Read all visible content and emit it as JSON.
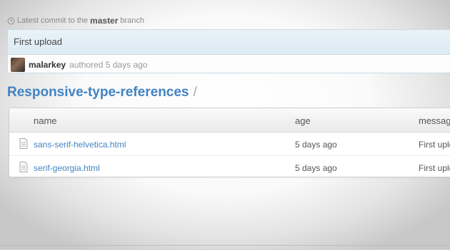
{
  "commit": {
    "latest_prefix": "Latest commit to the",
    "branch": "master",
    "branch_suffix": "branch",
    "message": "First upload",
    "author": "malarkey",
    "authored_text": "authored 5 days ago"
  },
  "repo": {
    "name": "Responsive-type-references",
    "separator": "/"
  },
  "table": {
    "headers": {
      "name": "name",
      "age": "age",
      "message": "message"
    },
    "rows": [
      {
        "name": "sans-serif-helvetica.html",
        "age": "5 days ago",
        "message": "First upload"
      },
      {
        "name": "serif-georgia.html",
        "age": "5 days ago",
        "message": "First upload"
      }
    ]
  },
  "icons": {
    "clock": "clock-icon",
    "file": "file-icon",
    "avatar": "avatar"
  },
  "colors": {
    "link": "#4183c4",
    "commit_bg": "#e3eff6"
  }
}
